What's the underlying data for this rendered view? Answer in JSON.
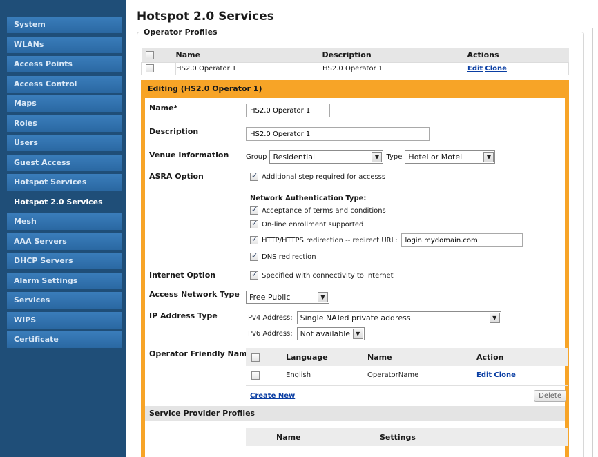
{
  "sidebar": {
    "items": [
      {
        "label": "System"
      },
      {
        "label": "WLANs"
      },
      {
        "label": "Access Points"
      },
      {
        "label": "Access Control"
      },
      {
        "label": "Maps"
      },
      {
        "label": "Roles"
      },
      {
        "label": "Users"
      },
      {
        "label": "Guest Access"
      },
      {
        "label": "Hotspot Services"
      },
      {
        "label": "Hotspot 2.0 Services"
      },
      {
        "label": "Mesh"
      },
      {
        "label": "AAA Servers"
      },
      {
        "label": "DHCP Servers"
      },
      {
        "label": "Alarm Settings"
      },
      {
        "label": "Services"
      },
      {
        "label": "WIPS"
      },
      {
        "label": "Certificate"
      }
    ],
    "active": "Hotspot 2.0 Services"
  },
  "page": {
    "title": "Hotspot 2.0 Services",
    "section": "Operator Profiles"
  },
  "profiles_table": {
    "headers": {
      "name": "Name",
      "description": "Description",
      "actions": "Actions"
    },
    "rows": [
      {
        "name": "HS2.0 Operator 1",
        "description": "HS2.0 Operator 1",
        "edit": "Edit",
        "clone": "Clone"
      }
    ]
  },
  "editor": {
    "title": "Editing (HS2.0 Operator 1)",
    "name_label": "Name*",
    "name_value": "HS2.0 Operator 1",
    "description_label": "Description",
    "description_value": "HS2.0 Operator 1",
    "venue_label": "Venue Information",
    "venue_group_label": "Group",
    "venue_group_value": "Residential",
    "venue_type_label": "Type",
    "venue_type_value": "Hotel or Motel",
    "asra_label": "ASRA Option",
    "asra_checkbox_label": "Additional step required for accesss",
    "network_auth_title": "Network Authentication Type:",
    "auth_terms": "Acceptance of terms and conditions",
    "auth_enrollment": "On-line enrollment supported",
    "auth_redirect": "HTTP/HTTPS redirection -- redirect URL:",
    "redirect_url": "login.mydomain.com",
    "auth_dns": "DNS redirection",
    "internet_label": "Internet Option",
    "internet_checkbox_label": "Specified with connectivity to internet",
    "access_network_label": "Access Network Type",
    "access_network_value": "Free Public",
    "ip_type_label": "IP Address Type",
    "ipv4_label": "IPv4 Address:",
    "ipv4_value": "Single NATed private address",
    "ipv6_label": "IPv6 Address:",
    "ipv6_value": "Not available",
    "friendly_name_label": "Operator Friendly Name",
    "friendly_table": {
      "headers": {
        "language": "Language",
        "name": "Name",
        "action": "Action"
      },
      "rows": [
        {
          "language": "English",
          "name": "OperatorName",
          "edit": "Edit",
          "clone": "Clone"
        }
      ],
      "create_new": "Create New",
      "delete": "Delete"
    },
    "service_provider_label": "Service Provider Profiles",
    "sp_table": {
      "headers": {
        "name": "Name",
        "settings": "Settings"
      }
    }
  },
  "colors": {
    "sidebar_bg": "#1f4e78",
    "sidebar_item": "#2f6fab",
    "editor_accent": "#f7a427"
  }
}
